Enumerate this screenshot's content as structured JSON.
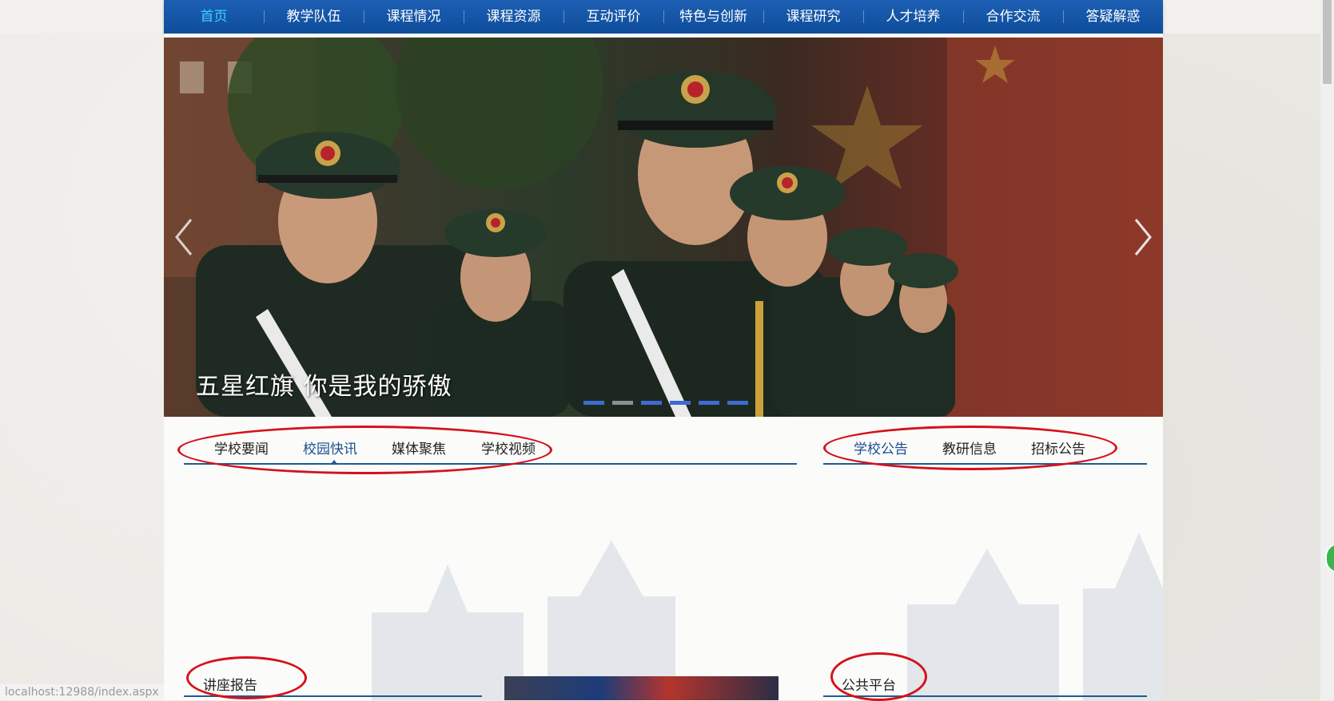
{
  "nav": {
    "items": [
      "首页",
      "教学队伍",
      "课程情况",
      "课程资源",
      "互动评价",
      "特色与创新",
      "课程研究",
      "人才培养",
      "合作交流",
      "答疑解惑"
    ],
    "active_index": 0
  },
  "hero": {
    "caption": "五星红旗 你是我的骄傲",
    "slide_count": 6,
    "current_slide": 2,
    "prev_icon": "chevron-left-icon",
    "next_icon": "chevron-right-icon"
  },
  "news_tabs": {
    "items": [
      "学校要闻",
      "校园快讯",
      "媒体聚焦",
      "学校视频"
    ],
    "active_index": 1
  },
  "notice_tabs": {
    "items": [
      "学校公告",
      "教研信息",
      "招标公告"
    ],
    "active_index": 0
  },
  "sections": {
    "lecture_title": "讲座报告",
    "platform_title": "公共平台"
  },
  "status_bar": {
    "url": "localhost:12988/index.aspx"
  },
  "colors": {
    "nav_bg": "#0e4d9b",
    "nav_active": "#3fd0ff",
    "accent_line": "#1e5b91",
    "annotation": "#d4121a"
  }
}
